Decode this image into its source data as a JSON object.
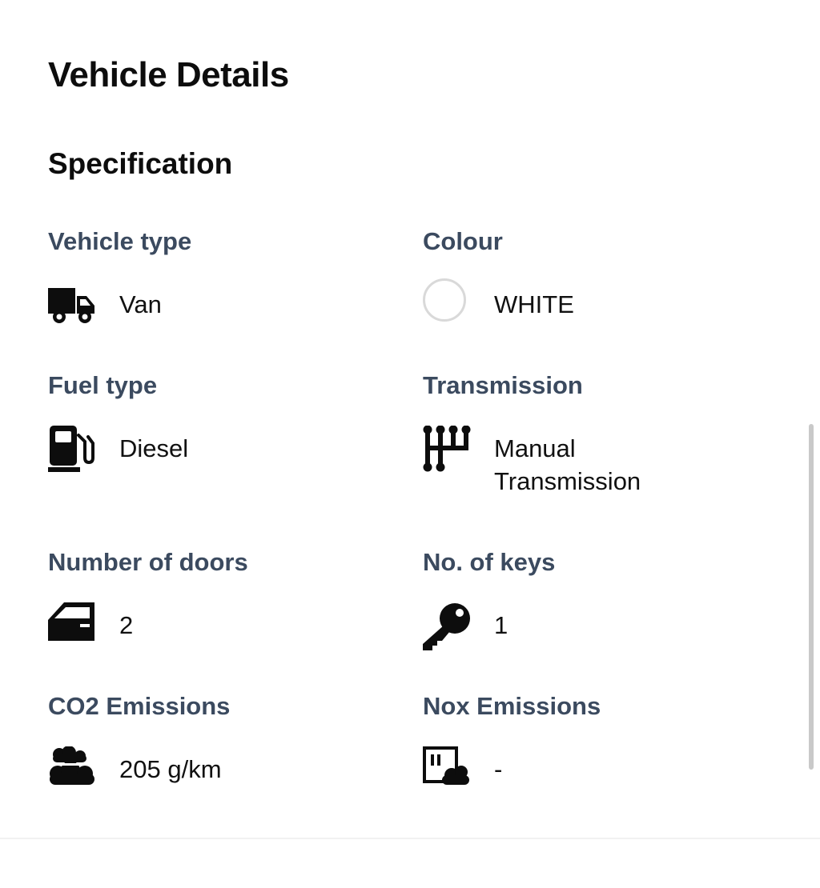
{
  "page": {
    "title": "Vehicle Details"
  },
  "specification": {
    "heading": "Specification",
    "vehicle_type": {
      "label": "Vehicle type",
      "value": "Van",
      "icon": "van-icon"
    },
    "colour": {
      "label": "Colour",
      "value": "WHITE",
      "swatch": "#ffffff",
      "icon": "colour-swatch"
    },
    "fuel_type": {
      "label": "Fuel type",
      "value": "Diesel",
      "icon": "fuel-pump-icon"
    },
    "transmission": {
      "label": "Transmission",
      "value": "Manual\nTransmission",
      "icon": "gear-shift-icon"
    },
    "doors": {
      "label": "Number of doors",
      "value": "2",
      "icon": "car-door-icon"
    },
    "keys": {
      "label": "No. of keys",
      "value": "1",
      "icon": "key-icon"
    },
    "co2": {
      "label": "CO2 Emissions",
      "value": "205 g/km",
      "icon": "clouds-icon"
    },
    "nox": {
      "label": "Nox Emissions",
      "value": "-",
      "icon": "factory-cloud-icon"
    }
  },
  "colors": {
    "label": "#3b4a5f",
    "text": "#111111",
    "swatch_border": "#d9d9d9"
  }
}
